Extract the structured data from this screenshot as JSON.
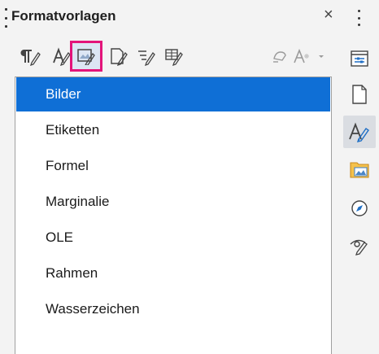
{
  "panel": {
    "title": "Formatvorlagen"
  },
  "toolbar": {
    "buttons": [
      {
        "icon": "paragraph-styles-icon"
      },
      {
        "icon": "character-styles-icon"
      },
      {
        "icon": "frame-styles-icon",
        "selected": true
      },
      {
        "icon": "page-styles-icon"
      },
      {
        "icon": "list-styles-icon"
      },
      {
        "icon": "table-styles-icon"
      },
      {
        "icon": "fill-format-mode-icon"
      },
      {
        "icon": "style-actions-icon"
      }
    ]
  },
  "list": {
    "items": [
      {
        "label": "Bilder",
        "selected": true
      },
      {
        "label": "Etiketten"
      },
      {
        "label": "Formel"
      },
      {
        "label": "Marginalie"
      },
      {
        "label": "OLE"
      },
      {
        "label": "Rahmen"
      },
      {
        "label": "Wasserzeichen"
      }
    ]
  },
  "sidebar": {
    "tabs": [
      {
        "icon": "properties-icon"
      },
      {
        "icon": "page-icon"
      },
      {
        "icon": "styles-icon",
        "active": true
      },
      {
        "icon": "gallery-icon"
      },
      {
        "icon": "navigator-icon"
      },
      {
        "icon": "style-inspector-icon"
      }
    ]
  },
  "colors": {
    "accent": "#0f6fd6",
    "highlight": "#e3147a"
  }
}
